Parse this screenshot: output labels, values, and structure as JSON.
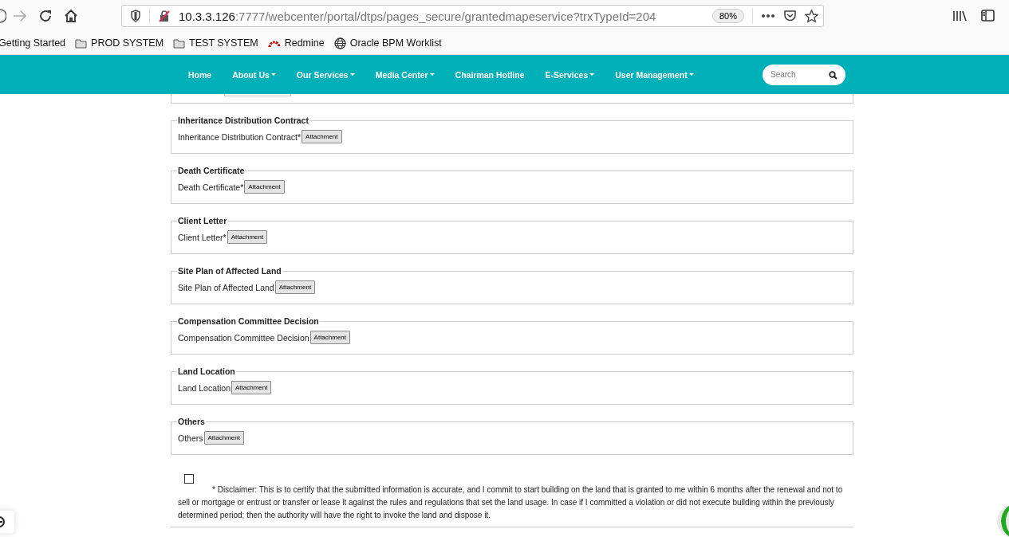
{
  "browser": {
    "url_host": "10.3.3.126",
    "url_rest": ":7777/webcenter/portal/dtps/pages_secure/grantedmapeservice?trxTypeId=204",
    "zoom": "80%",
    "bookmarks": [
      {
        "label": "Getting Started",
        "kind": "plain"
      },
      {
        "label": "PROD SYSTEM",
        "kind": "folder"
      },
      {
        "label": "TEST SYSTEM",
        "kind": "folder"
      },
      {
        "label": "Redmine",
        "kind": "redmine"
      },
      {
        "label": "Oracle BPM Worklist",
        "kind": "globe"
      }
    ]
  },
  "nav": {
    "items": [
      {
        "label": "Home",
        "dropdown": false
      },
      {
        "label": "About Us",
        "dropdown": true
      },
      {
        "label": "Our Services",
        "dropdown": true
      },
      {
        "label": "Media Center",
        "dropdown": true
      },
      {
        "label": "Chairman Hotline",
        "dropdown": false
      },
      {
        "label": "E-Services",
        "dropdown": true
      },
      {
        "label": "User Management",
        "dropdown": true
      }
    ],
    "search": {
      "placeholder": "Search"
    }
  },
  "sections": [
    {
      "legend": "Inheritance Distribution Contract",
      "label": "Inheritance Distribution Contract*",
      "button": "Attachment"
    },
    {
      "legend": "Death Certificate",
      "label": "Death Certificate*",
      "button": "Attachment"
    },
    {
      "legend": "Client Letter",
      "label": "Client Letter*",
      "button": "Attachment"
    },
    {
      "legend": "Site Plan of Affected Land",
      "label": "Site Plan of Affected Land",
      "button": "Attachment"
    },
    {
      "legend": "Compensation Committee Decision",
      "label": "Compensation Committee Decision",
      "button": "Attachment"
    },
    {
      "legend": "Land Location",
      "label": "Land Location",
      "button": "Attachment"
    },
    {
      "legend": "Others",
      "label": "Others",
      "button": "Attachment"
    }
  ],
  "disclaimer": {
    "checked": false,
    "text": "* Disclaimer: This is to certify that the submitted information is accurate, and I commit to start building on the land that is granted to me within 6 months after the renewal and not to sell or mortgage or entrust or transfer or lease it against the rules and regulations that set the land usage. In case if I committed a violation or did not execute building within the previously determined period; then the authority will have the right to invoke the land and dispose it."
  }
}
